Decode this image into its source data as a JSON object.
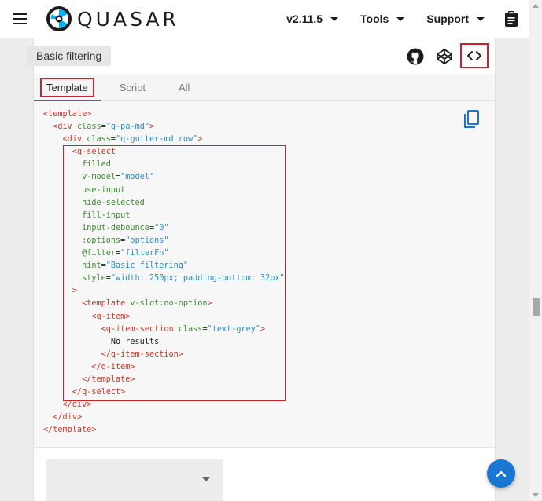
{
  "header": {
    "brand": "QUASAR",
    "version": "v2.11.5",
    "tools_label": "Tools",
    "support_label": "Support",
    "icons": [
      "menu-icon",
      "quasar-logo",
      "clipboard-icon"
    ]
  },
  "example": {
    "title": "Basic filtering",
    "icons": [
      "github-icon",
      "codepen-icon",
      "code-icon"
    ],
    "tabs": [
      "Template",
      "Script",
      "All"
    ],
    "active_tab": "Template",
    "copy_icon": "copy-icon",
    "code_lines": [
      "<template>",
      "  <div class=\"q-pa-md\">",
      "    <div class=\"q-gutter-md row\">",
      "      <q-select",
      "        filled",
      "        v-model=\"model\"",
      "        use-input",
      "        hide-selected",
      "        fill-input",
      "        input-debounce=\"0\"",
      "        :options=\"options\"",
      "        @filter=\"filterFn\"",
      "        hint=\"Basic filtering\"",
      "        style=\"width: 250px; padding-bottom: 32px\"",
      "      >",
      "        <template v-slot:no-option>",
      "          <q-item>",
      "            <q-item-section class=\"text-grey\">",
      "              No results",
      "            </q-item-section>",
      "          </q-item>",
      "        </template>",
      "      </q-select>",
      "    </div>",
      "  </div>",
      "</template>"
    ]
  },
  "preview": {
    "select_value": "",
    "caret_icon": "arrow-drop-down-icon"
  },
  "fab": {
    "icon": "chevron-up-icon"
  },
  "colors": {
    "primary": "#1976d2",
    "highlight": "#d0202c",
    "tag": "#c0392b",
    "attr": "#3a8a2f",
    "string": "#2a8bc2"
  }
}
